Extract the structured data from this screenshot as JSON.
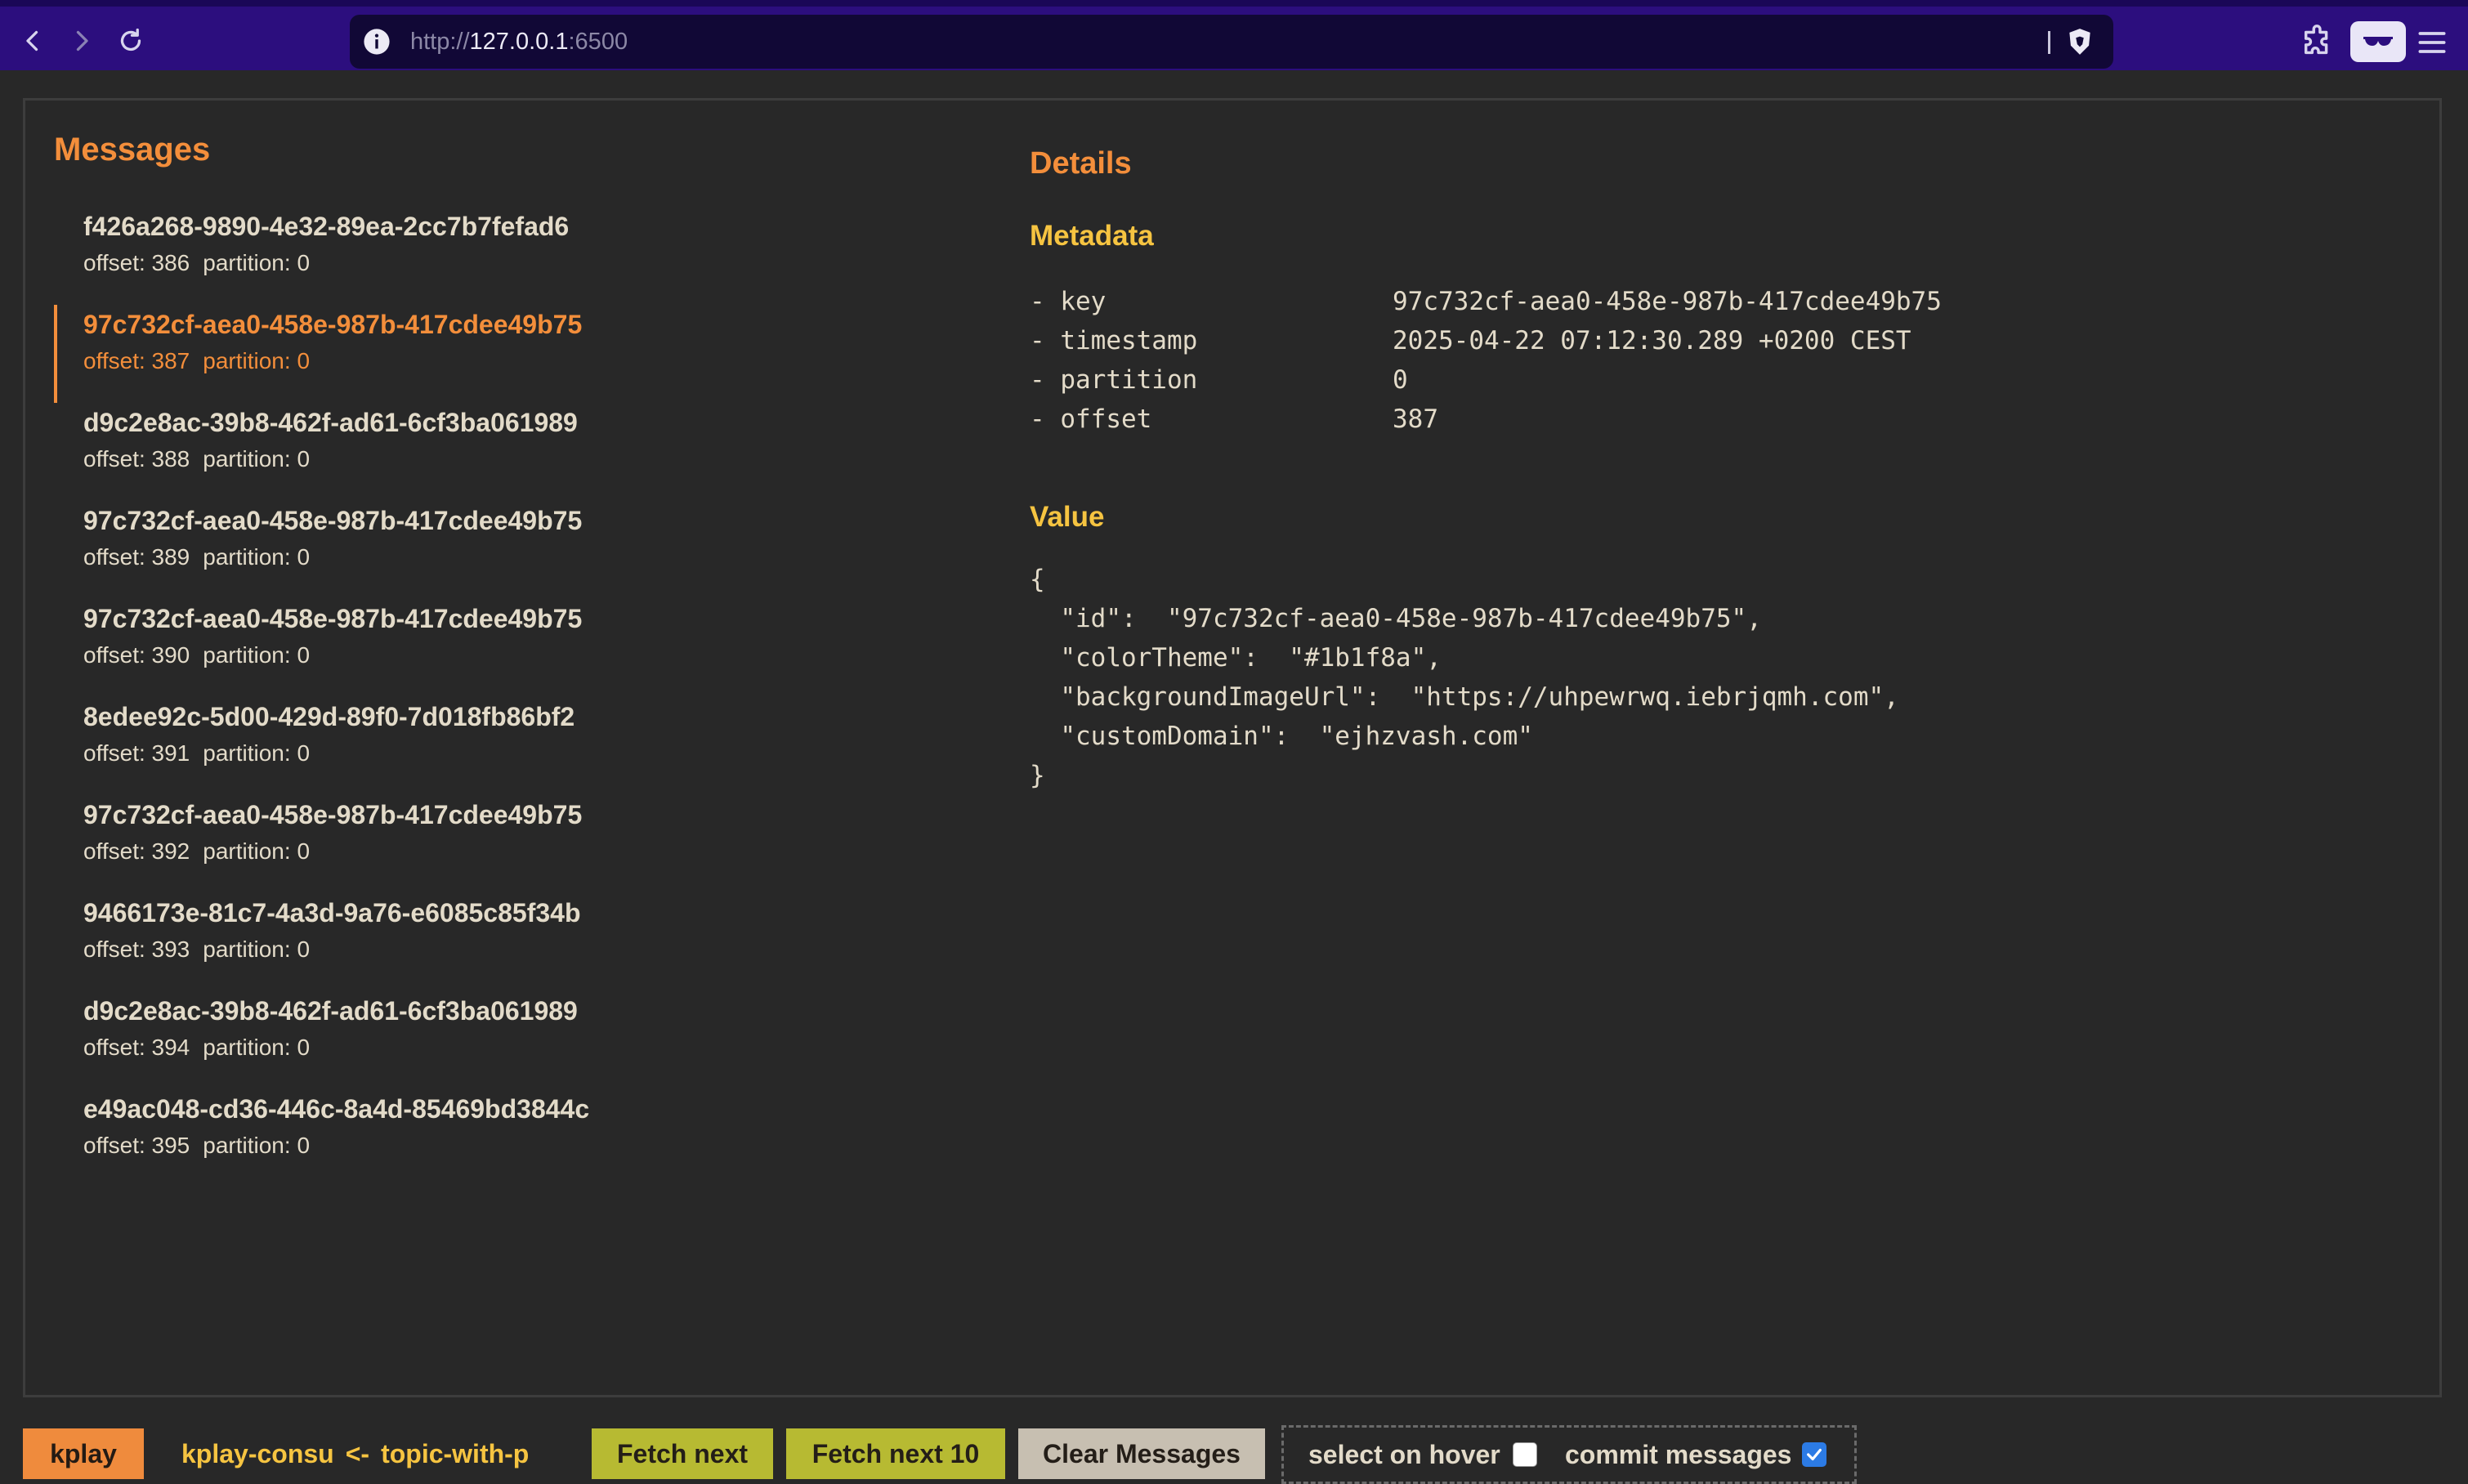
{
  "browser": {
    "url_scheme": "http://",
    "url_host": "127.0.0.1",
    "url_port": ":6500"
  },
  "messages": {
    "heading": "Messages",
    "selected_index": 1,
    "items": [
      {
        "key": "f426a268-9890-4e32-89ea-2cc7b7fefad6",
        "offset": "offset: 386",
        "partition": "partition: 0"
      },
      {
        "key": "97c732cf-aea0-458e-987b-417cdee49b75",
        "offset": "offset: 387",
        "partition": "partition: 0"
      },
      {
        "key": "d9c2e8ac-39b8-462f-ad61-6cf3ba061989",
        "offset": "offset: 388",
        "partition": "partition: 0"
      },
      {
        "key": "97c732cf-aea0-458e-987b-417cdee49b75",
        "offset": "offset: 389",
        "partition": "partition: 0"
      },
      {
        "key": "97c732cf-aea0-458e-987b-417cdee49b75",
        "offset": "offset: 390",
        "partition": "partition: 0"
      },
      {
        "key": "8edee92c-5d00-429d-89f0-7d018fb86bf2",
        "offset": "offset: 391",
        "partition": "partition: 0"
      },
      {
        "key": "97c732cf-aea0-458e-987b-417cdee49b75",
        "offset": "offset: 392",
        "partition": "partition: 0"
      },
      {
        "key": "9466173e-81c7-4a3d-9a76-e6085c85f34b",
        "offset": "offset: 393",
        "partition": "partition: 0"
      },
      {
        "key": "d9c2e8ac-39b8-462f-ad61-6cf3ba061989",
        "offset": "offset: 394",
        "partition": "partition: 0"
      },
      {
        "key": "e49ac048-cd36-446c-8a4d-85469bd3844c",
        "offset": "offset: 395",
        "partition": "partition: 0"
      }
    ]
  },
  "details": {
    "heading": "Details",
    "metadata_heading": "Metadata",
    "metadata": [
      {
        "label": "- key",
        "value": "97c732cf-aea0-458e-987b-417cdee49b75"
      },
      {
        "label": "- timestamp",
        "value": "2025-04-22 07:12:30.289 +0200 CEST"
      },
      {
        "label": "- partition",
        "value": "0"
      },
      {
        "label": "- offset",
        "value": "387"
      }
    ],
    "value_heading": "Value",
    "value_lines": [
      "{",
      "  \"id\":  \"97c732cf-aea0-458e-987b-417cdee49b75\",",
      "  \"colorTheme\":  \"#1b1f8a\",",
      "  \"backgroundImageUrl\":  \"https://uhpewrwq.iebrjqmh.com\",",
      "  \"customDomain\":  \"ejhzvash.com\"",
      "}"
    ]
  },
  "toolbar": {
    "app_name": "kplay",
    "consumer_group": "kplay-consu",
    "arrow": "<-",
    "topic": "topic-with-p",
    "fetch_next_label": "Fetch next",
    "fetch_next_10_label": "Fetch next 10",
    "clear_label": "Clear Messages",
    "select_on_hover_label": "select on hover",
    "select_on_hover_checked": false,
    "commit_messages_label": "commit messages",
    "commit_messages_checked": true
  },
  "colors": {
    "accent_orange": "#f38e3b",
    "accent_yellow": "#f6c441",
    "text": "#e3dbc9",
    "background": "#282828",
    "fetch_button": "#b7ba32",
    "clear_button": "#c7bfb1"
  }
}
